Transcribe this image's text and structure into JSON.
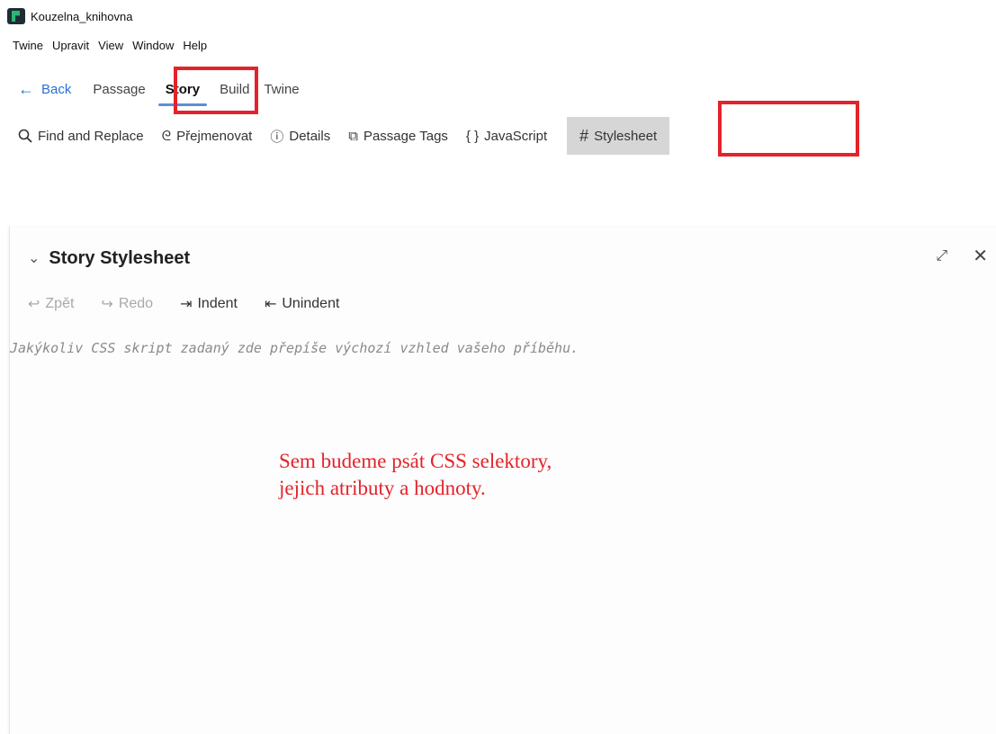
{
  "window": {
    "title": "Kouzelna_knihovna"
  },
  "menu": [
    "Twine",
    "Upravit",
    "View",
    "Window",
    "Help"
  ],
  "top_tabs": {
    "back": "Back",
    "items": [
      "Passage",
      "Story",
      "Build",
      "Twine"
    ],
    "active": "Story"
  },
  "story_toolbar": {
    "items": [
      {
        "icon": "search-icon",
        "glyph": "🔍",
        "label": "Find and Replace"
      },
      {
        "icon": "rename-icon",
        "glyph": "ᘓ",
        "label": "Přejmenovat"
      },
      {
        "icon": "info-icon",
        "glyph": "ⓘ",
        "label": "Details"
      },
      {
        "icon": "tags-icon",
        "glyph": "⧉",
        "label": "Passage Tags"
      },
      {
        "icon": "braces-icon",
        "glyph": "{ }",
        "label": "JavaScript"
      },
      {
        "icon": "hash-icon",
        "glyph": "#",
        "label": "Stylesheet"
      }
    ],
    "selected": "Stylesheet"
  },
  "dialog": {
    "title": "Story Stylesheet",
    "toolbar": {
      "undo": "Zpět",
      "redo": "Redo",
      "indent": "Indent",
      "unindent": "Unindent"
    },
    "placeholder": "Jakýkoliv CSS skript zadaný zde přepíše výchozí vzhled vašeho příběhu."
  },
  "annotation": {
    "line1": "Sem budeme psát CSS selektory,",
    "line2": "jejich atributy a hodnoty."
  },
  "colors": {
    "highlight": "#e3232b",
    "accent": "#2a6fd1",
    "selected_bg": "#d6d6d6"
  }
}
